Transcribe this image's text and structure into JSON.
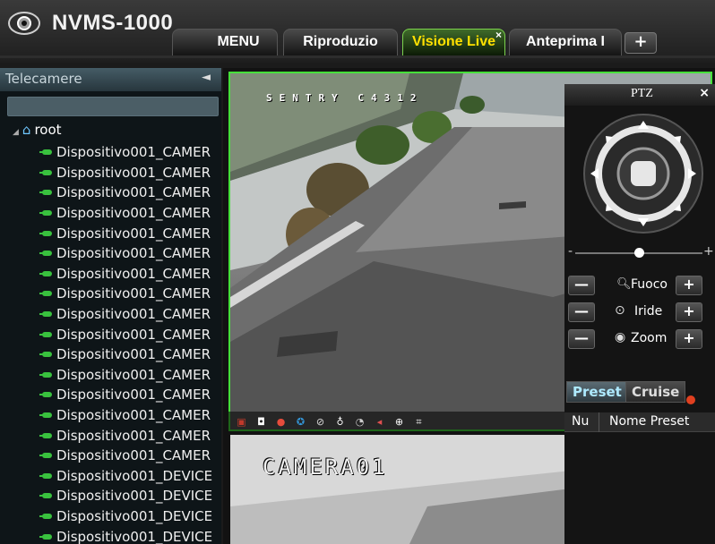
{
  "app": {
    "title": "NVMS-1000"
  },
  "tabs": [
    {
      "label": "MENU"
    },
    {
      "label": "Riproduzio"
    },
    {
      "label": "Visione Live",
      "active": true
    },
    {
      "label": "Anteprima I"
    }
  ],
  "tab_add_label": "+",
  "tab_close_glyph": "×",
  "sidebar": {
    "title": "Telecamere",
    "collapse_glyph": "◄",
    "root_label": "root",
    "devices": [
      "Dispositivo001_CAMER",
      "Dispositivo001_CAMER",
      "Dispositivo001_CAMER",
      "Dispositivo001_CAMER",
      "Dispositivo001_CAMER",
      "Dispositivo001_CAMER",
      "Dispositivo001_CAMER",
      "Dispositivo001_CAMER",
      "Dispositivo001_CAMER",
      "Dispositivo001_CAMER",
      "Dispositivo001_CAMER",
      "Dispositivo001_CAMER",
      "Dispositivo001_CAMER",
      "Dispositivo001_CAMER",
      "Dispositivo001_CAMER",
      "Dispositivo001_CAMER",
      "Dispositivo001_DEVICE",
      "Dispositivo001_DEVICE",
      "Dispositivo001_DEVICE",
      "Dispositivo001_DEVICE"
    ]
  },
  "video": {
    "top_osd": "SENTRY C4312",
    "bottom_osd": "CAMERA01",
    "toolbar_icons": [
      "snapshot-close-icon",
      "camera-icon",
      "record-icon",
      "ptz-icon",
      "no-audio-icon",
      "microphone-icon",
      "stream-icon",
      "speaker-icon",
      "zoom-in-icon",
      "fullscreen-icon"
    ]
  },
  "ptz": {
    "title": "PTZ",
    "close_glyph": "×",
    "slider_minus": "-",
    "slider_plus": "+",
    "speed_level": 0.5,
    "controls": [
      {
        "label": "Fuoco",
        "minus": "—",
        "plus": "+"
      },
      {
        "label": "Iride",
        "minus": "—",
        "plus": "+"
      },
      {
        "label": "Zoom",
        "minus": "—",
        "plus": "+"
      }
    ],
    "tabs": [
      "Preset",
      "Cruise"
    ],
    "preset_columns": [
      "Nu",
      "Nome Preset"
    ]
  },
  "colors": {
    "active_tab_border": "#7bd24d",
    "active_tab_text": "#ffe000",
    "video_border": "#46e03a",
    "camera_icon": "#39c13e"
  }
}
